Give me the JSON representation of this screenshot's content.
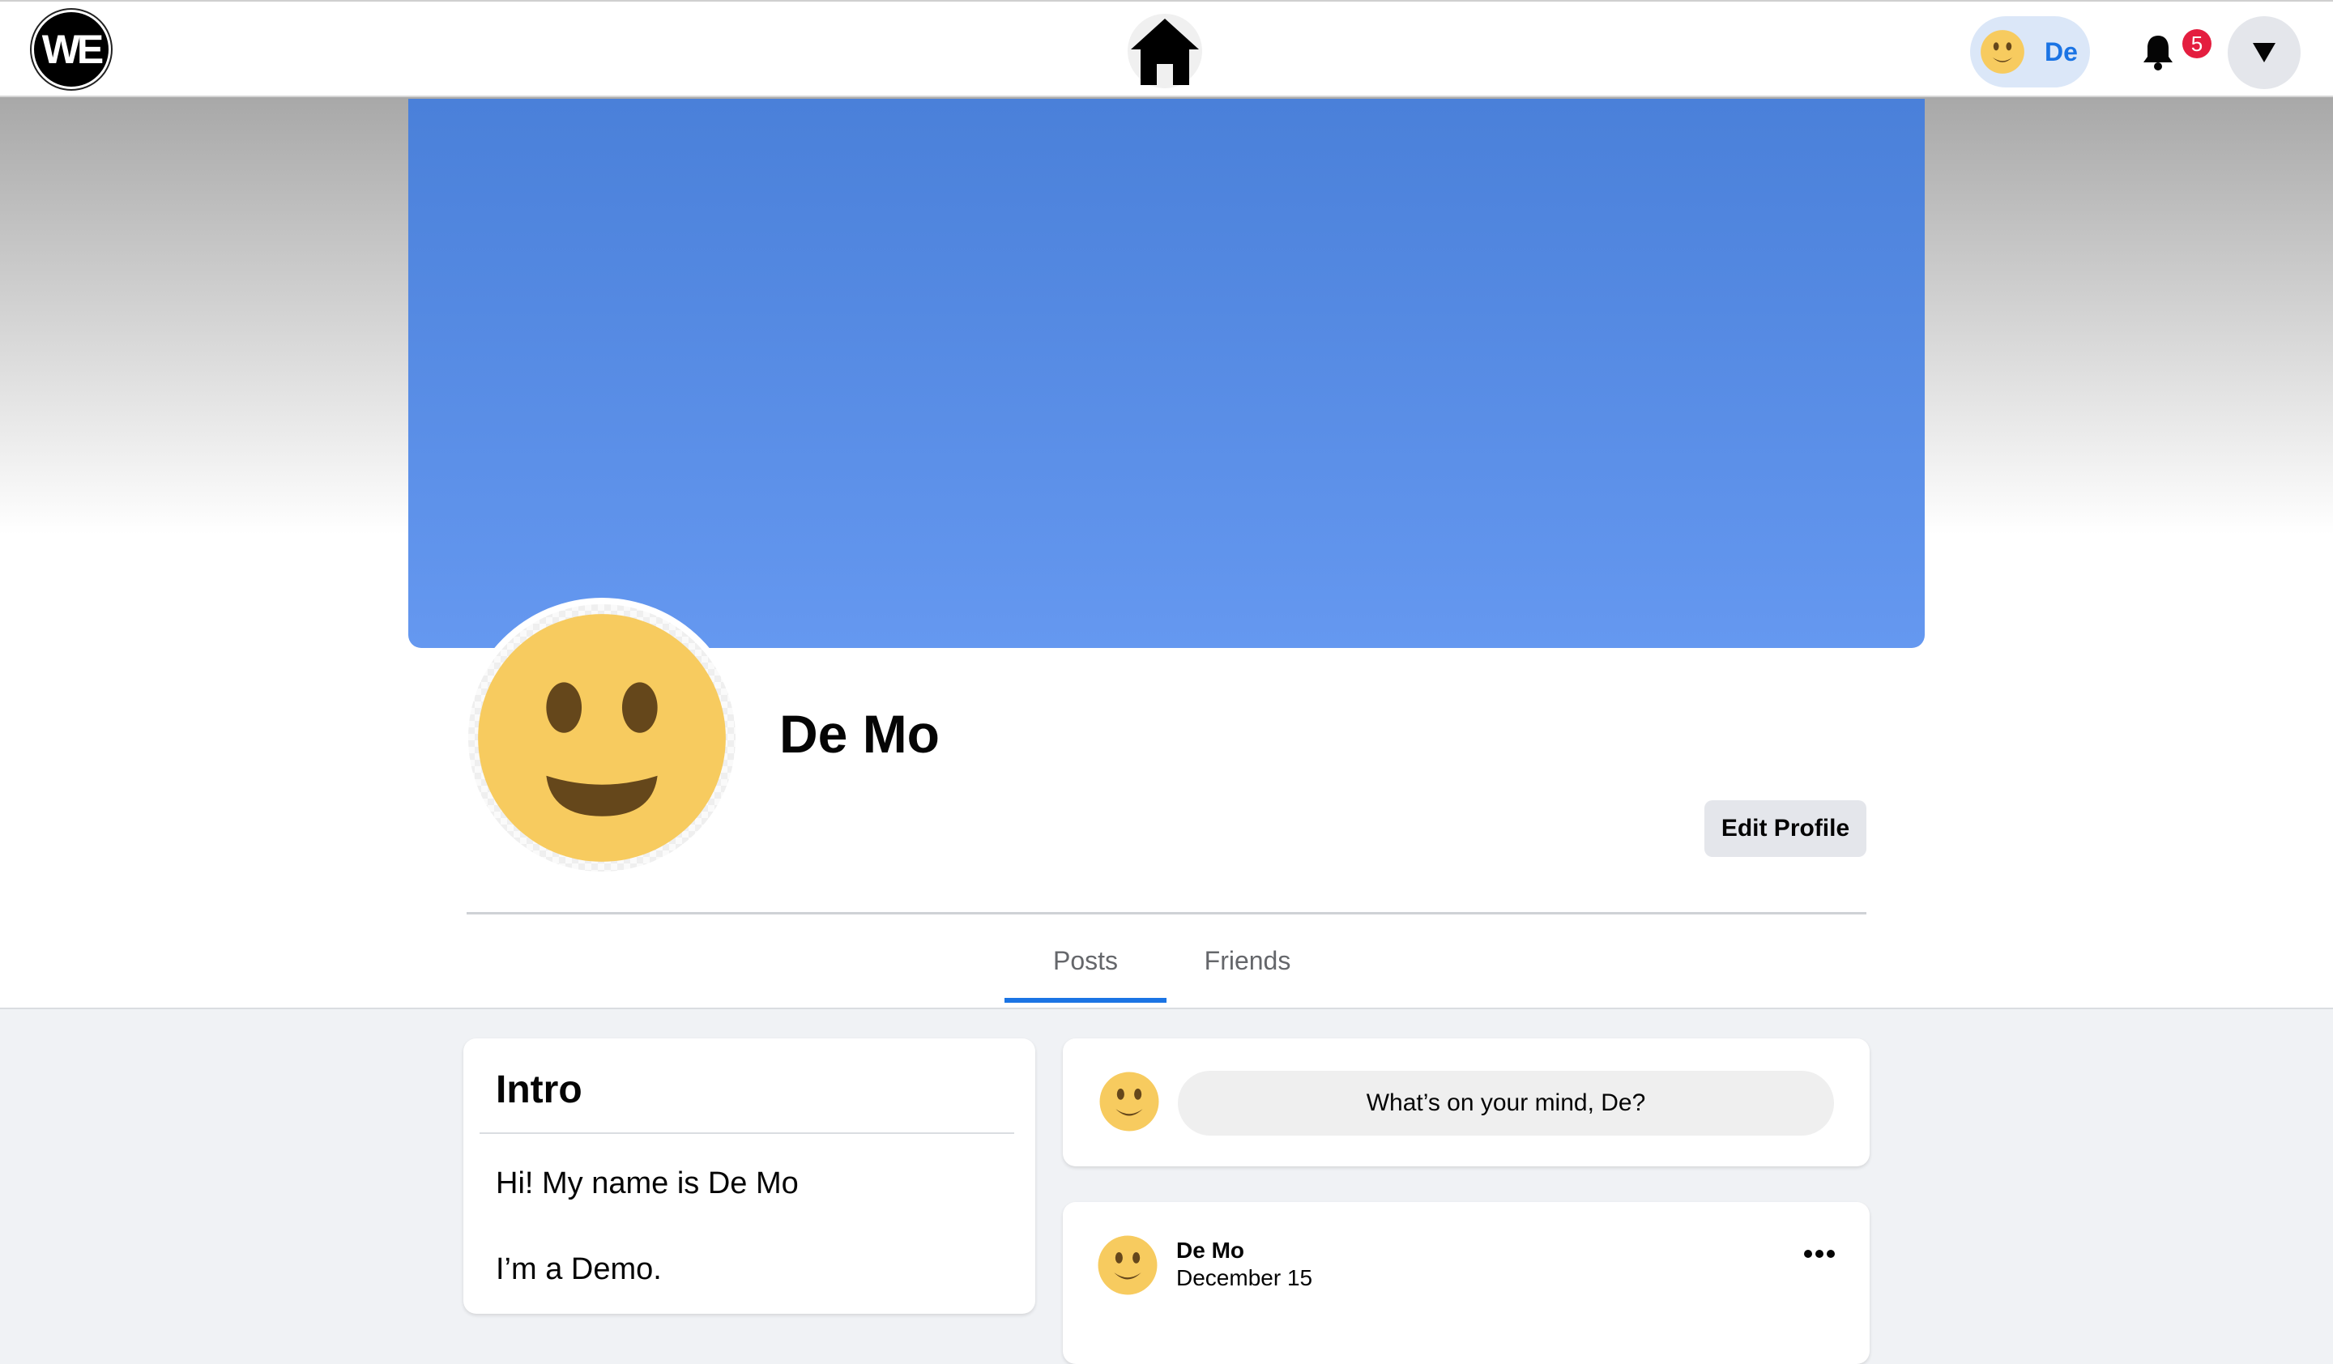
{
  "nav": {
    "logo_text": "WE",
    "home_icon": "home-icon",
    "user_chip": {
      "label": "De",
      "avatar_icon": "smiley-face-icon"
    },
    "notifications": {
      "icon": "bell-icon",
      "count": "5"
    },
    "menu_icon": "triangle-down-icon"
  },
  "profile": {
    "name": "De Mo",
    "avatar_icon": "smiley-face-icon",
    "edit_button": "Edit Profile",
    "cover_color": "#5a8de6"
  },
  "tabs": [
    {
      "label": "Posts",
      "active": true
    },
    {
      "label": "Friends",
      "active": false
    }
  ],
  "intro": {
    "title": "Intro",
    "lines": [
      "Hi! My name is De Mo",
      "I’m a Demo."
    ]
  },
  "composer": {
    "placeholder": "What’s on your mind, De?",
    "avatar_icon": "smiley-face-icon"
  },
  "posts": [
    {
      "author": "De Mo",
      "date": "December 15",
      "menu_icon": "more-dots-icon"
    }
  ],
  "colors": {
    "accent": "#1b74e4",
    "badge": "#e41e3f",
    "smiley": "#f7cb5f"
  }
}
